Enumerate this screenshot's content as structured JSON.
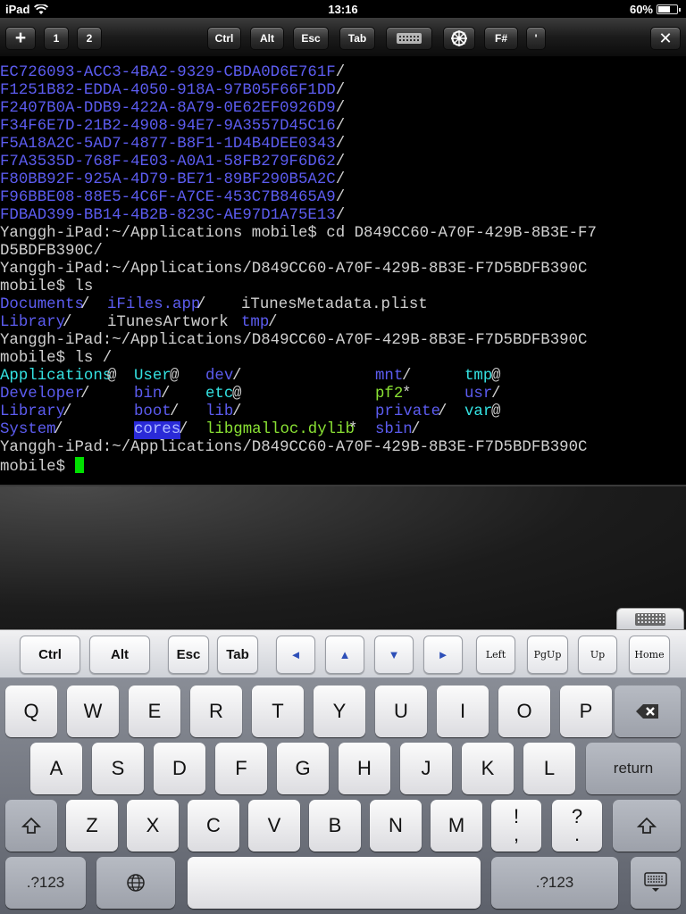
{
  "status": {
    "carrier": "iPad",
    "time": "13:16",
    "battery": "60%",
    "battery_level": 0.6
  },
  "toolbar": {
    "plus": "+",
    "win1": "1",
    "win2": "2",
    "ctrl": "Ctrl",
    "alt": "Alt",
    "esc": "Esc",
    "tab": "Tab",
    "fsharp": "F#",
    "quote": "'",
    "close": "✕"
  },
  "terminal": {
    "lines": [
      {
        "segments": [
          {
            "text": "EC726093-ACC3-4BA2-9329-CBDA0D6E761F",
            "cls": "dir"
          },
          {
            "text": "/",
            "cls": ""
          }
        ]
      },
      {
        "segments": [
          {
            "text": "F1251B82-EDDA-4050-918A-97B05F66F1DD",
            "cls": "dir"
          },
          {
            "text": "/",
            "cls": ""
          }
        ]
      },
      {
        "segments": [
          {
            "text": "F2407B0A-DDB9-422A-8A79-0E62EF0926D9",
            "cls": "dir"
          },
          {
            "text": "/",
            "cls": ""
          }
        ]
      },
      {
        "segments": [
          {
            "text": "F34F6E7D-21B2-4908-94E7-9A3557D45C16",
            "cls": "dir"
          },
          {
            "text": "/",
            "cls": ""
          }
        ]
      },
      {
        "segments": [
          {
            "text": "F5A18A2C-5AD7-4877-B8F1-1D4B4DEE0343",
            "cls": "dir"
          },
          {
            "text": "/",
            "cls": ""
          }
        ]
      },
      {
        "segments": [
          {
            "text": "F7A3535D-768F-4E03-A0A1-58FB279F6D62",
            "cls": "dir"
          },
          {
            "text": "/",
            "cls": ""
          }
        ]
      },
      {
        "segments": [
          {
            "text": "F80BB92F-925A-4D79-BE71-89BF290B5A2C",
            "cls": "dir"
          },
          {
            "text": "/",
            "cls": ""
          }
        ]
      },
      {
        "segments": [
          {
            "text": "F96BBE08-88E5-4C6F-A7CE-453C7B8465A9",
            "cls": "dir"
          },
          {
            "text": "/",
            "cls": ""
          }
        ]
      },
      {
        "segments": [
          {
            "text": "FDBAD399-BB14-4B2B-823C-AE97D1A75E13",
            "cls": "dir"
          },
          {
            "text": "/",
            "cls": ""
          }
        ]
      },
      {
        "segments": [
          {
            "text": "Yanggh-iPad:~/Applications mobile$ cd D849CC60-A70F-429B-8B3E-F7",
            "cls": ""
          }
        ]
      },
      {
        "segments": [
          {
            "text": "D5BDFB390C/",
            "cls": ""
          }
        ]
      },
      {
        "segments": [
          {
            "text": "Yanggh-iPad:~/Applications/D849CC60-A70F-429B-8B3E-F7D5BDFB390C",
            "cls": ""
          }
        ]
      },
      {
        "segments": [
          {
            "text": "mobile$ ls",
            "cls": ""
          }
        ]
      },
      {
        "segments": [
          {
            "text": "Documents",
            "cls": "dir",
            "col": 0
          },
          {
            "text": "/",
            "cls": "",
            "col": 9
          },
          {
            "text": "iFiles.app",
            "cls": "dir",
            "col": 12
          },
          {
            "text": "/",
            "cls": "",
            "col": 22
          },
          {
            "text": "iTunesMetadata.plist",
            "cls": "",
            "col": 27
          }
        ]
      },
      {
        "segments": [
          {
            "text": "Library",
            "cls": "dir",
            "col": 0
          },
          {
            "text": "/",
            "cls": "",
            "col": 7
          },
          {
            "text": "iTunesArtwork",
            "cls": "",
            "col": 12
          },
          {
            "text": "tmp",
            "cls": "dir",
            "col": 27
          },
          {
            "text": "/",
            "cls": "",
            "col": 30
          }
        ]
      },
      {
        "segments": [
          {
            "text": "Yanggh-iPad:~/Applications/D849CC60-A70F-429B-8B3E-F7D5BDFB390C",
            "cls": ""
          }
        ]
      },
      {
        "segments": [
          {
            "text": "mobile$ ls /",
            "cls": ""
          }
        ]
      },
      {
        "segments": [
          {
            "text": "Applications",
            "cls": "link",
            "col": 0
          },
          {
            "text": "@",
            "cls": "",
            "col": 12
          },
          {
            "text": "User",
            "cls": "link",
            "col": 15
          },
          {
            "text": "@",
            "cls": "",
            "col": 19
          },
          {
            "text": "dev",
            "cls": "dir",
            "col": 23
          },
          {
            "text": "/",
            "cls": "",
            "col": 26
          },
          {
            "text": "mnt",
            "cls": "dir",
            "col": 42
          },
          {
            "text": "/",
            "cls": "",
            "col": 45
          },
          {
            "text": "tmp",
            "cls": "link",
            "col": 52
          },
          {
            "text": "@",
            "cls": "",
            "col": 55
          }
        ]
      },
      {
        "segments": [
          {
            "text": "Developer",
            "cls": "dir",
            "col": 0
          },
          {
            "text": "/",
            "cls": "",
            "col": 9
          },
          {
            "text": "bin",
            "cls": "dir",
            "col": 15
          },
          {
            "text": "/",
            "cls": "",
            "col": 18
          },
          {
            "text": "etc",
            "cls": "link",
            "col": 23
          },
          {
            "text": "@",
            "cls": "",
            "col": 26
          },
          {
            "text": "pf2",
            "cls": "exec",
            "col": 42
          },
          {
            "text": "*",
            "cls": "",
            "col": 45
          },
          {
            "text": "usr",
            "cls": "dir",
            "col": 52
          },
          {
            "text": "/",
            "cls": "",
            "col": 55
          }
        ]
      },
      {
        "segments": [
          {
            "text": "Library",
            "cls": "dir",
            "col": 0
          },
          {
            "text": "/",
            "cls": "",
            "col": 7
          },
          {
            "text": "boot",
            "cls": "dir",
            "col": 15
          },
          {
            "text": "/",
            "cls": "",
            "col": 19
          },
          {
            "text": "lib",
            "cls": "dir",
            "col": 23
          },
          {
            "text": "/",
            "cls": "",
            "col": 26
          },
          {
            "text": "private",
            "cls": "dir",
            "col": 42
          },
          {
            "text": "/",
            "cls": "",
            "col": 49
          },
          {
            "text": "var",
            "cls": "link",
            "col": 52
          },
          {
            "text": "@",
            "cls": "",
            "col": 55
          }
        ]
      },
      {
        "segments": [
          {
            "text": "System",
            "cls": "dir",
            "col": 0
          },
          {
            "text": "/",
            "cls": "",
            "col": 6
          },
          {
            "text": "cores",
            "cls": "sel",
            "col": 15
          },
          {
            "text": "/",
            "cls": "",
            "col": 20
          },
          {
            "text": "libgmalloc.dylib",
            "cls": "exec",
            "col": 23
          },
          {
            "text": "*",
            "cls": "",
            "col": 39
          },
          {
            "text": "sbin",
            "cls": "dir",
            "col": 42
          },
          {
            "text": "/",
            "cls": "",
            "col": 46
          }
        ]
      },
      {
        "segments": [
          {
            "text": "Yanggh-iPad:~/Applications/D849CC60-A70F-429B-8B3E-F7D5BDFB390C",
            "cls": ""
          }
        ]
      },
      {
        "segments": [
          {
            "text": "mobile$ ",
            "cls": ""
          }
        ],
        "cursor": true
      }
    ]
  },
  "extra_keys": [
    "Ctrl",
    "Alt",
    "Esc",
    "Tab",
    "◄",
    "▲",
    "▼",
    "►",
    "Left",
    "PgUp",
    "Up",
    "Home"
  ],
  "keyboard": {
    "row1": [
      "Q",
      "W",
      "E",
      "R",
      "T",
      "Y",
      "U",
      "I",
      "O",
      "P"
    ],
    "row2": [
      "A",
      "S",
      "D",
      "F",
      "G",
      "H",
      "J",
      "K",
      "L"
    ],
    "return": "return",
    "row3": [
      "Z",
      "X",
      "C",
      "V",
      "B",
      "N",
      "M"
    ],
    "punct1": [
      "!",
      ","
    ],
    "punct2": [
      "?",
      "."
    ],
    "numbers_label": ".?123"
  }
}
